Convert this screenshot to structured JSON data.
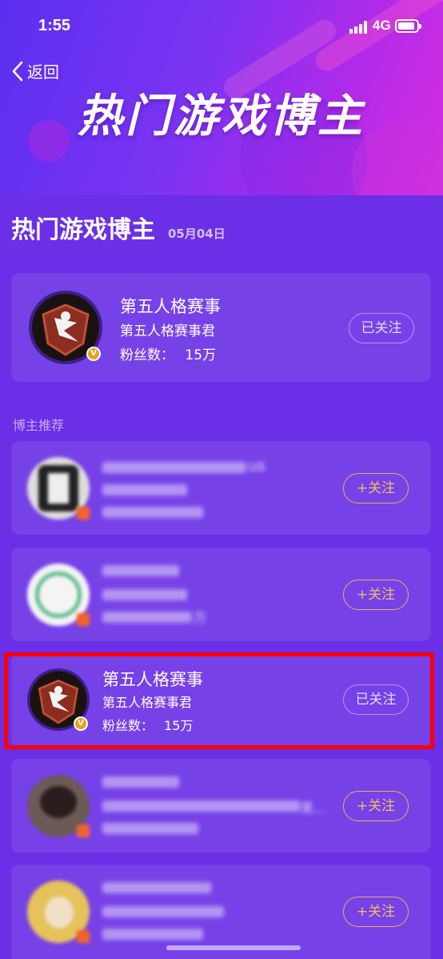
{
  "status": {
    "time": "1:55",
    "network": "4G"
  },
  "nav": {
    "back_label": "返回",
    "banner_title": "热门游戏博主"
  },
  "section": {
    "title": "热门游戏博主",
    "date": "05月04日"
  },
  "top_blogger": {
    "name": "第五人格赛事",
    "subtitle": "第五人格赛事君",
    "fans_label": "粉丝数：",
    "fans_value": "15万",
    "button": "已关注"
  },
  "recommend_label": "博主推荐",
  "recommendations": [
    {
      "name": "us",
      "button": "+关注"
    },
    {
      "name": "",
      "fans_value": "万",
      "button": "+关注"
    },
    {
      "name": "第五人格赛事",
      "subtitle": "第五人格赛事君",
      "fans_label": "粉丝数：",
      "fans_value": "15万",
      "button": "已关注"
    },
    {
      "extra": "芙…",
      "button": "+关注"
    },
    {
      "name": "",
      "button": "+关注"
    }
  ]
}
